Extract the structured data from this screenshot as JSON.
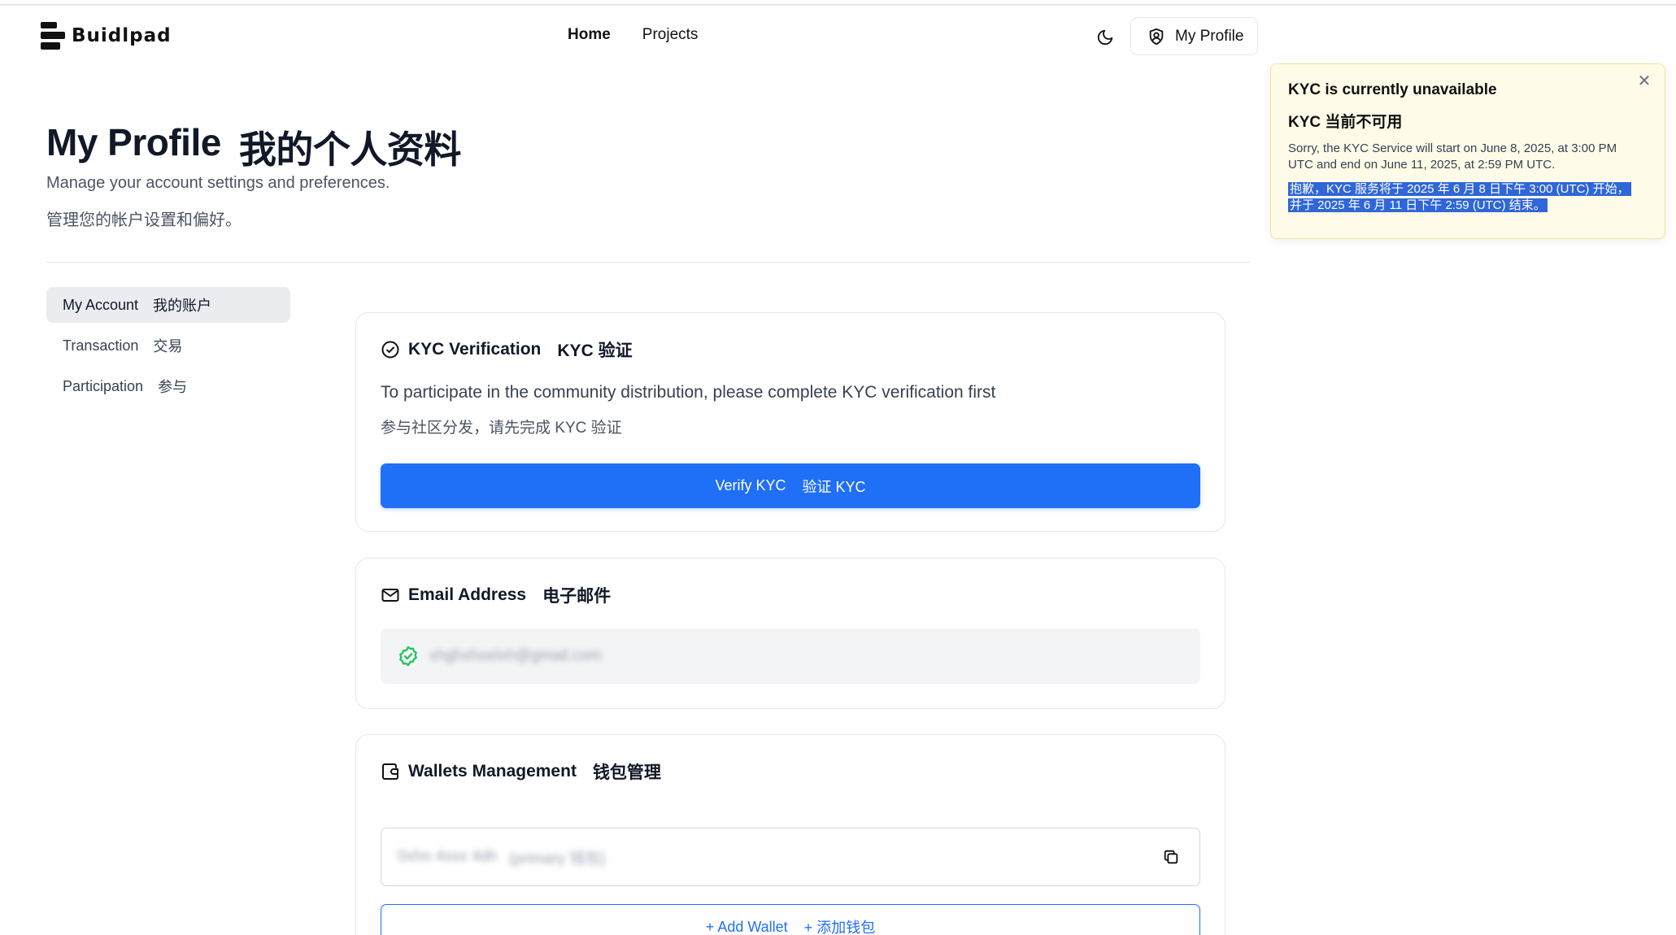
{
  "header": {
    "logo_text": "Buidlpad",
    "nav": [
      {
        "label": "Home",
        "active": true
      },
      {
        "label": "Projects",
        "active": false
      }
    ],
    "theme_icon": "moon-icon",
    "profile_button": "My Profile"
  },
  "page": {
    "title": "My Profile",
    "title_cn": "我的个人资料",
    "subtitle": "Manage your account settings and preferences.",
    "subtitle_cn": "管理您的帐户设置和偏好。"
  },
  "sidebar": {
    "items": [
      {
        "label": "My Account",
        "label_cn": "我的账户",
        "active": true
      },
      {
        "label": "Transaction",
        "label_cn": "交易",
        "active": false
      },
      {
        "label": "Participation",
        "label_cn": "参与",
        "active": false
      }
    ]
  },
  "kyc": {
    "title": "KYC Verification",
    "title_cn": "KYC 验证",
    "description": "To participate in the community distribution, please complete KYC verification first",
    "description_cn": "参与社区分发，请先完成 KYC 验证",
    "button": "Verify KYC",
    "button_cn": "验证 KYC"
  },
  "email": {
    "title": "Email Address",
    "title_cn": "电子邮件",
    "value": "xhghxhxelxh@gmail.com"
  },
  "wallets": {
    "title": "Wallets Management",
    "title_cn": "钱包管理",
    "address": "0xhn 4xxx 4dh",
    "tag": "(primary 钱包)",
    "add_button": "+ Add Wallet",
    "add_button_cn": "+ 添加钱包"
  },
  "toast": {
    "title": "KYC is currently unavailable",
    "title_cn": "KYC 当前不可用",
    "body": "Sorry, the KYC Service will start on June 8, 2025, at 3:00 PM UTC and end on June 11, 2025, at 2:59 PM UTC.",
    "body_cn": "抱歉，KYC 服务将于 2025 年 6 月 8 日下午 3:00 (UTC) 开始，并于 2025 年 6 月 11 日下午 2:59 (UTC) 结束。"
  },
  "colors": {
    "primary": "#1f6ff7",
    "toast_bg": "#fefbe8",
    "success": "#22c55e"
  }
}
